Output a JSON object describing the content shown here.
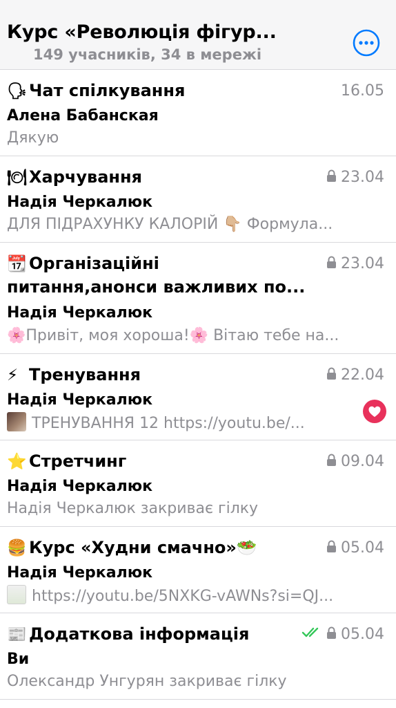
{
  "header": {
    "title": "Курс «Революція фігур...",
    "subtitle": "149 учасників, 34 в мережі",
    "more_icon": "ellipsis-circle-icon"
  },
  "colors": {
    "accent": "#007aff",
    "secondary_text": "#8e8e93",
    "reaction": "#e8315b",
    "read_check": "#34c759"
  },
  "topics": [
    {
      "icon": "🗣",
      "title": "Чат спілкування",
      "date": "16.05",
      "locked": false,
      "sender": "Алена Бабанская",
      "preview": "Дякую"
    },
    {
      "icon": "🍽",
      "title": "Харчування",
      "date": "23.04",
      "locked": true,
      "sender": "Надія Черкалюк",
      "preview": "ДЛЯ ПІДРАХУНКУ КАЛОРІЙ 👇🏼 Формула..."
    },
    {
      "icon": "📆",
      "title_line1": "Організаційні",
      "title_line2": "питання,анонси важливих по...",
      "date": "23.04",
      "locked": true,
      "sender": "Надія Черкалюк",
      "preview": "🌸Привіт, моя хороша!🌸 Вітаю тебе на..."
    },
    {
      "icon": "⚡",
      "title": "Тренування",
      "date": "22.04",
      "locked": true,
      "sender": "Надія Черкалюк",
      "preview": "ТРЕНУВАННЯ 12 https://youtu.be/...",
      "reaction": "heart-icon"
    },
    {
      "icon": "⭐",
      "title": "Стретчинг",
      "date": "09.04",
      "locked": true,
      "sender": "Надія Черкалюк",
      "preview": "Надія Черкалюк закриває гілку"
    },
    {
      "icon": "🍔",
      "title": "Курс «Худни смачно»🥗",
      "date": "05.04",
      "locked": true,
      "sender": "Надія Черкалюк",
      "preview": "https://youtu.be/5NXKG-vAWNs?si=QJ..."
    },
    {
      "icon": "📰",
      "title": "Додаткова інформація",
      "date": "05.04",
      "locked": true,
      "read": true,
      "sender": "Ви",
      "preview": "Олександр Унгурян закриває гілку"
    }
  ]
}
